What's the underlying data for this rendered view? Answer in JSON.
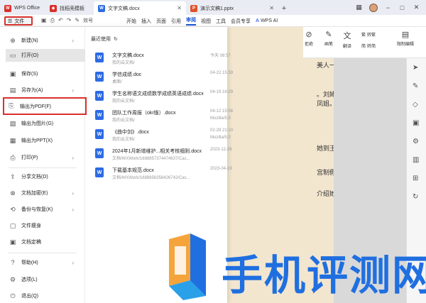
{
  "tabbar": {
    "tabs": [
      {
        "label": "WPS Office",
        "icon": "wps-logo-icon",
        "color": "#d9302c"
      },
      {
        "label": "找稻壳模板",
        "icon": "daoke-icon",
        "color": "#d9302c"
      },
      {
        "label": "文字文稿.docx",
        "icon": "writer-icon",
        "color": "#2d6be4"
      },
      {
        "label": "演示文稿1.pptx",
        "icon": "presentation-icon",
        "color": "#e0522a"
      }
    ],
    "add": "+"
  },
  "ribbon": {
    "menu_label": "文件",
    "menu_glyph": "☰",
    "style_label": "效号",
    "tabs": [
      "开始",
      "插入",
      "页面",
      "引用",
      "审阅",
      "视图",
      "工具",
      "会员专享"
    ],
    "active_tab": "审阅",
    "ai_label": "WPS AI"
  },
  "toolbar_right": [
    {
      "label": "拒绝",
      "icon": "reject-icon"
    },
    {
      "label": "画笔",
      "icon": "pen-icon"
    },
    {
      "label": "翻译",
      "icon": "translate-icon"
    },
    {
      "label": "转繁",
      "icon": "to-traditional-icon"
    },
    {
      "label": "转简",
      "icon": "to-simplified-icon"
    },
    {
      "label": "限制编辑",
      "icon": "restrict-edit-icon"
    }
  ],
  "sidebar": {
    "items": [
      {
        "label": "新建(N)",
        "icon": "new-doc-icon",
        "arrow": true
      },
      {
        "label": "打开(O)",
        "icon": "open-folder-icon",
        "arrow": false
      },
      {
        "label": "保存(S)",
        "icon": "save-icon",
        "arrow": false
      },
      {
        "label": "另存为(A)",
        "icon": "save-as-icon",
        "arrow": true
      },
      {
        "label": "输出为PDF(F)",
        "icon": "pdf-icon",
        "arrow": false
      },
      {
        "label": "输出为图片(G)",
        "icon": "image-export-icon",
        "arrow": false
      },
      {
        "label": "输出为PPT(X)",
        "icon": "ppt-export-icon",
        "arrow": false
      },
      {
        "label": "打印(P)",
        "icon": "print-icon",
        "arrow": true
      },
      {
        "label": "分享文档(D)",
        "icon": "share-icon",
        "arrow": false
      },
      {
        "label": "文档加密(E)",
        "icon": "encrypt-icon",
        "arrow": true
      },
      {
        "label": "备份与恢复(K)",
        "icon": "backup-icon",
        "arrow": true
      },
      {
        "label": "文件瘦身",
        "icon": "slim-icon",
        "arrow": false
      },
      {
        "label": "文档定稿",
        "icon": "finalize-icon",
        "arrow": false
      },
      {
        "label": "帮助(H)",
        "icon": "help-icon",
        "arrow": true
      },
      {
        "label": "选项(L)",
        "icon": "options-icon",
        "arrow": false
      },
      {
        "label": "退出(Q)",
        "icon": "exit-icon",
        "arrow": false
      }
    ]
  },
  "recent": {
    "heading": "最近使用",
    "files": [
      {
        "name": "文字文稿.docx",
        "path": "我的云文档/",
        "time": "今天 08:57",
        "source": ""
      },
      {
        "name": "学信成绩.doc",
        "path": "桌面/",
        "time": "04-22 15:39",
        "source": ""
      },
      {
        "name": "学生名称语文成绩数学成绩英语成绩.docx",
        "path": "我的云文档/",
        "time": "04-19 16:29",
        "source": ""
      },
      {
        "name": "团队工作周报（okr版）.docx",
        "path": "我的云文档/",
        "time": "04-12 15:56",
        "source": "Mozilla/5.0"
      },
      {
        "name": "《曲中剑》.docx",
        "path": "我的云文档/",
        "time": "02-28 21:10",
        "source": "Mozilla/5.0"
      },
      {
        "name": "2024年1月新增维护...相关考核细则.docx",
        "path": "文档/WXWork/1688857374474637/Cac...",
        "time": "2023-12-26",
        "source": ""
      },
      {
        "name": "下载基本规范.docx",
        "path": "文档/WXWork/1688856358426742/Cac...",
        "time": "2023-04-19",
        "source": ""
      }
    ]
  },
  "document": {
    "lines": [
      "美人一样的模",
      "。刘姥姥先",
      "凤姐。凤姐初",
      "她到王夫人处",
      "宫制假花，黛",
      "介绍她弟秦钟，"
    ]
  },
  "watermark": {
    "text": "手机评测网",
    "color": "#1f6fe0"
  }
}
